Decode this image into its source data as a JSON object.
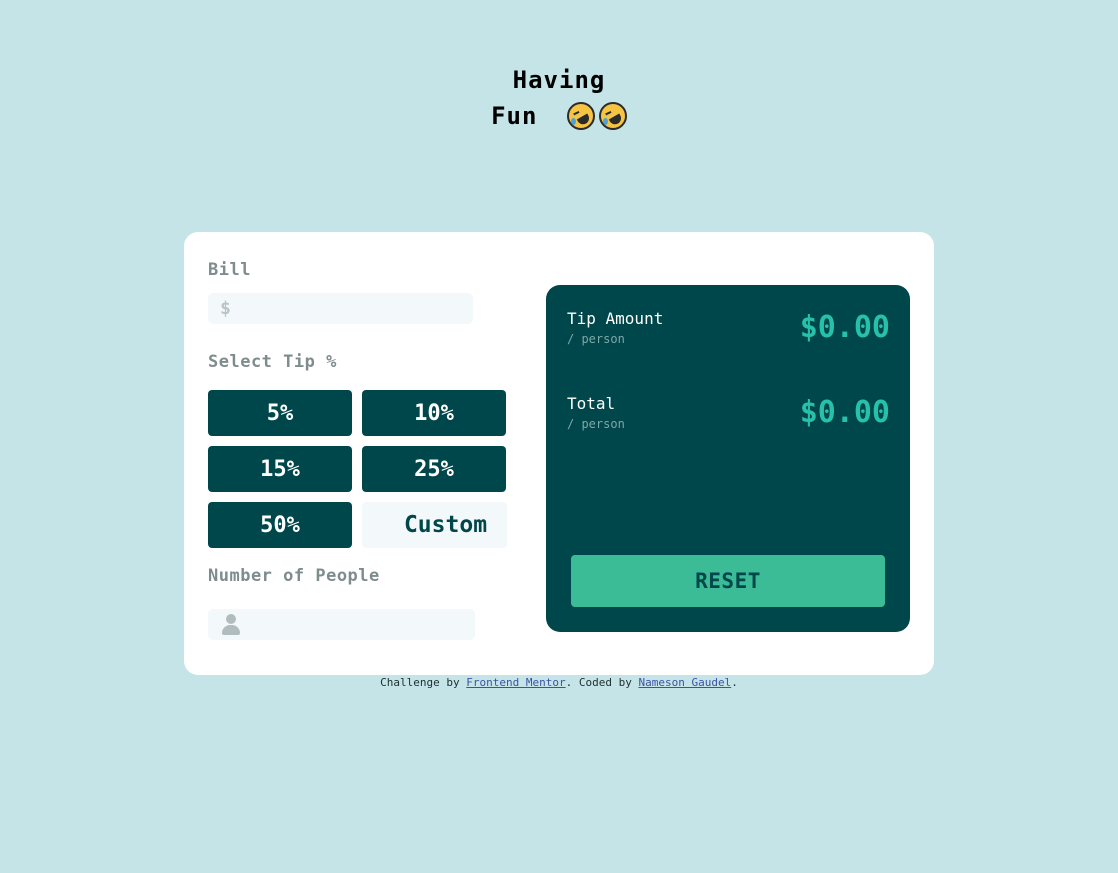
{
  "logo": {
    "line1": "Having",
    "line2": "Fun"
  },
  "form": {
    "bill_label": "Bill",
    "bill_value": "",
    "bill_icon": "dollar-icon",
    "select_tip_label": "Select Tip %",
    "tip_options": [
      "5%",
      "10%",
      "15%",
      "25%",
      "50%"
    ],
    "custom_label": "Custom",
    "people_label": "Number of People",
    "people_value": "",
    "people_icon": "person-icon"
  },
  "result": {
    "tip_amount_label": "Tip Amount",
    "tip_amount_sub": "/ person",
    "tip_amount_value": "$0.00",
    "total_label": "Total",
    "total_sub": "/ person",
    "total_value": "$0.00",
    "reset_label": "RESET"
  },
  "attribution": {
    "prefix": "Challenge by ",
    "mentor_link": "Frontend Mentor",
    "middle": ". Coded by ",
    "author_link": "Nameson Gaudel",
    "suffix": "."
  },
  "colors": {
    "background": "#c5e4e7",
    "dark_cyan": "#00474b",
    "accent": "#26c0ab",
    "reset_bg": "#3bbc97"
  }
}
